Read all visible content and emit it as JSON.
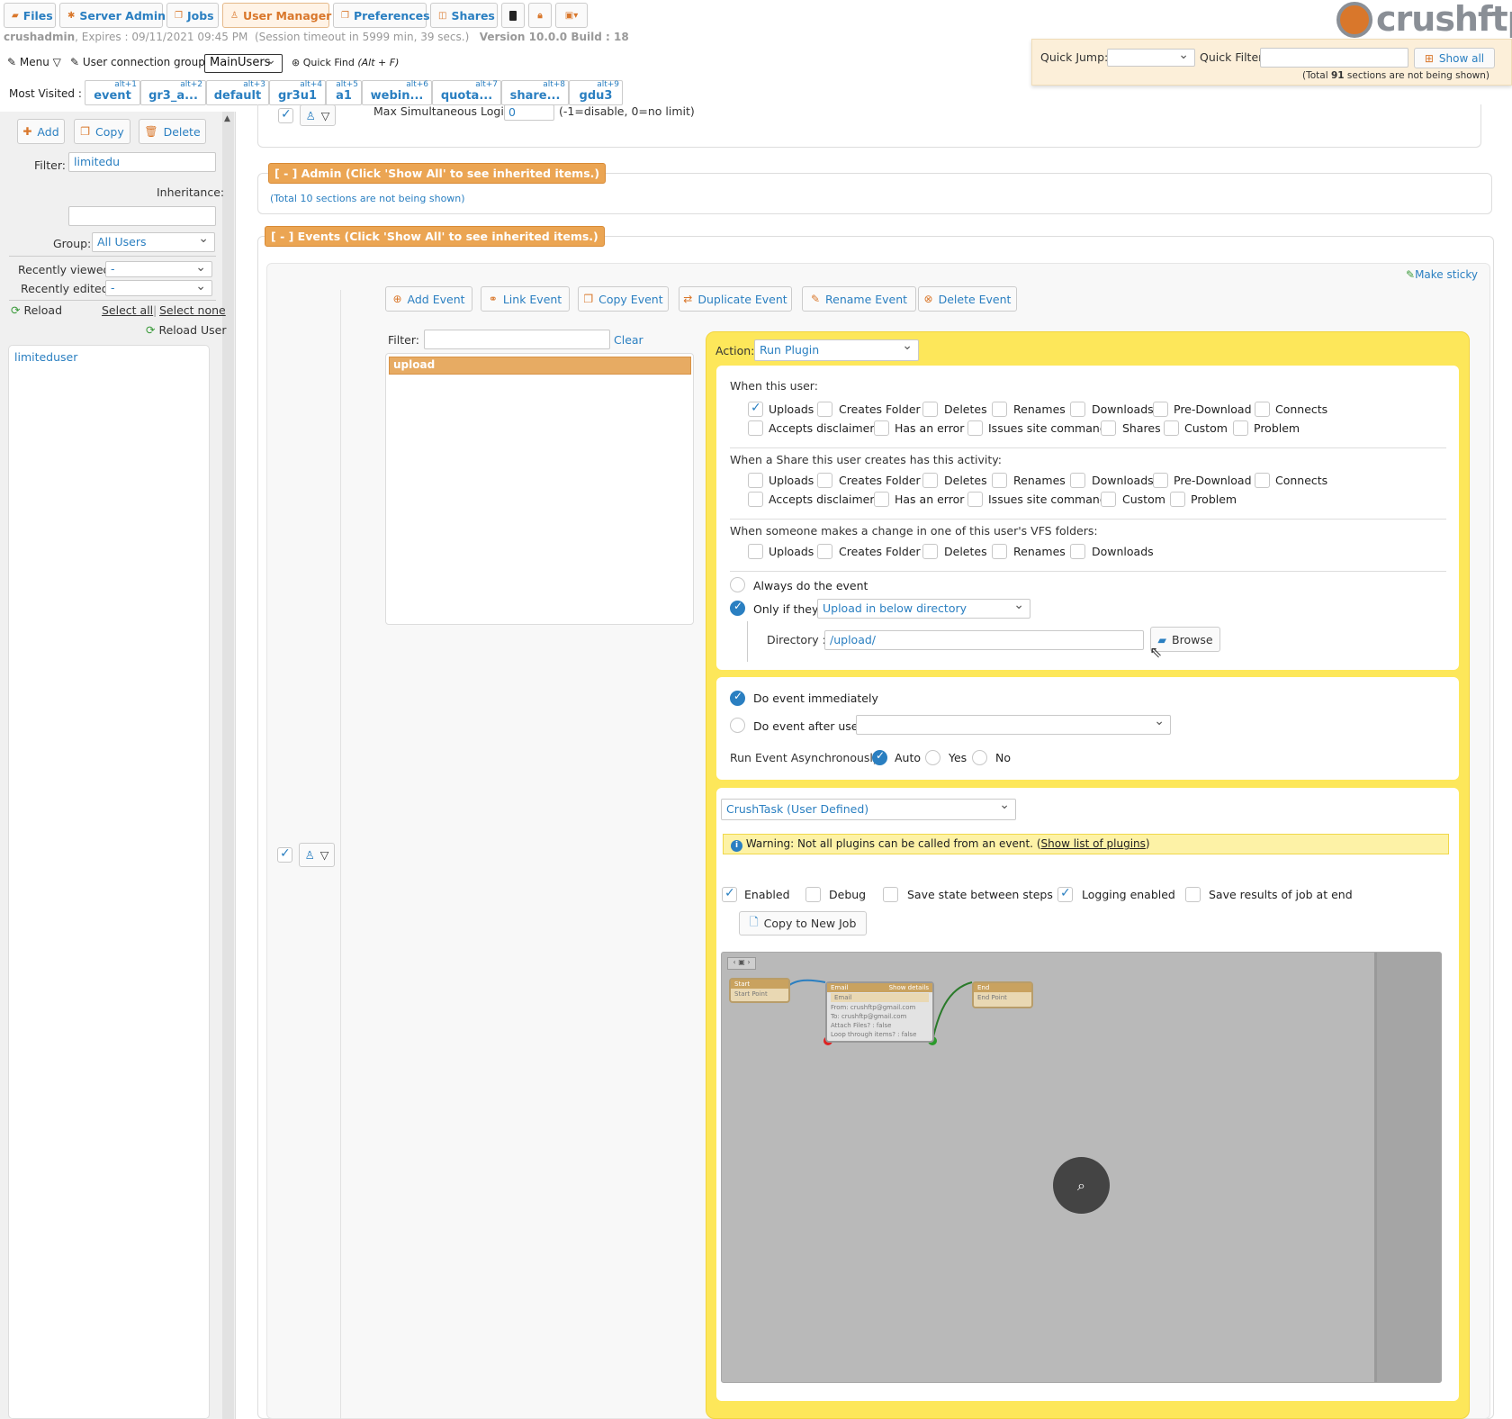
{
  "nav": {
    "tabs": [
      {
        "label": "Files",
        "icon": "folder-icon"
      },
      {
        "label": "Server Admin",
        "icon": "gear-icon"
      },
      {
        "label": "Jobs",
        "icon": "copy-icon"
      },
      {
        "label": "User Manager",
        "icon": "user-icon"
      },
      {
        "label": "Preferences",
        "icon": "copy-icon"
      },
      {
        "label": "Shares",
        "icon": "share-icon"
      }
    ],
    "logo_text": "crushftp"
  },
  "session": {
    "user": "crushadmin",
    "expires": ", Expires : 09/11/2021 09:45 PM",
    "timeout": "(Session timeout in 5999 min, 39 secs.)",
    "version": "Version 10.0.0 Build : 18"
  },
  "toolbar": {
    "menu_label": "Menu",
    "group_label": "User connection group:",
    "group_value": "MainUsers",
    "quick_find_label": "Quick Find",
    "quick_find_shortcut": "(Alt + F)",
    "most_visited_label": "Most Visited :",
    "most_visited": [
      {
        "key": "alt+1",
        "label": "event"
      },
      {
        "key": "alt+2",
        "label": "gr3_a..."
      },
      {
        "key": "alt+3",
        "label": "default"
      },
      {
        "key": "alt+4",
        "label": "gr3u1"
      },
      {
        "key": "alt+5",
        "label": "a1"
      },
      {
        "key": "alt+6",
        "label": "webin..."
      },
      {
        "key": "alt+7",
        "label": "quota..."
      },
      {
        "key": "alt+8",
        "label": "share..."
      },
      {
        "key": "alt+9",
        "label": "gdu3"
      }
    ]
  },
  "quick": {
    "jump_label": "Quick Jump:",
    "filter_label": "Quick Filter",
    "show_all": "Show all",
    "hidden_prefix": "(Total ",
    "hidden_count": "91",
    "hidden_suffix": " sections are not being shown)"
  },
  "sidebar": {
    "add": "Add",
    "copy": "Copy",
    "delete": "Delete",
    "filter_label": "Filter:",
    "filter_value": "limitedu",
    "inheritance_label": "Inheritance:",
    "group_label": "Group:",
    "group_value": "All Users",
    "recently_viewed_label": "Recently viewed:",
    "recently_viewed_value": "-",
    "recently_edited_label": "Recently edited:",
    "recently_edited_value": "-",
    "reload": "Reload",
    "select_all": "Select all",
    "separator": "|",
    "select_none": "Select none",
    "reload_user": "Reload User",
    "users": [
      "limiteduser"
    ]
  },
  "main": {
    "max_login_label": "Max Simultaneous Login:",
    "max_login_value": "0",
    "max_login_hint": "(-1=disable, 0=no limit)",
    "admin_section": "[ - ] Admin (Click 'Show All' to see inherited items.)",
    "admin_hidden_prefix": "(Total ",
    "admin_hidden_count": "10",
    "admin_hidden_suffix": " sections are not being shown)",
    "events_section": "[ - ] Events (Click 'Show All' to see inherited items.)",
    "make_sticky": "Make sticky"
  },
  "events": {
    "buttons": [
      "Add Event",
      "Link Event",
      "Copy Event",
      "Duplicate Event",
      "Rename Event",
      "Delete Event"
    ],
    "filter_label": "Filter:",
    "clear": "Clear",
    "list": [
      "upload"
    ],
    "action_label": "Action:",
    "action_value": "Run Plugin",
    "when_user_label": "When this user:",
    "when_user_row1": [
      {
        "label": "Uploads",
        "checked": true
      },
      {
        "label": "Creates Folder",
        "checked": false
      },
      {
        "label": "Deletes",
        "checked": false
      },
      {
        "label": "Renames",
        "checked": false
      },
      {
        "label": "Downloads",
        "checked": false
      },
      {
        "label": "Pre-Download",
        "checked": false
      },
      {
        "label": "Connects",
        "checked": false
      }
    ],
    "when_user_row2": [
      {
        "label": "Accepts disclaimer",
        "checked": false
      },
      {
        "label": "Has an error",
        "checked": false
      },
      {
        "label": "Issues site command",
        "checked": false
      },
      {
        "label": "Shares",
        "checked": false
      },
      {
        "label": "Custom",
        "checked": false
      },
      {
        "label": "Problem",
        "checked": false
      }
    ],
    "share_label": "When a Share this user creates has this activity:",
    "share_row1": [
      "Uploads",
      "Creates Folder",
      "Deletes",
      "Renames",
      "Downloads",
      "Pre-Download",
      "Connects"
    ],
    "share_row2": [
      "Accepts disclaimer",
      "Has an error",
      "Issues site command",
      "Custom",
      "Problem"
    ],
    "vfs_label": "When someone makes a change in one of this user's VFS folders:",
    "vfs_row": [
      "Uploads",
      "Creates Folder",
      "Deletes",
      "Renames",
      "Downloads"
    ],
    "always": "Always do the event",
    "only_if": "Only if they",
    "only_if_value": "Upload in below directory",
    "directory_label": "Directory :",
    "directory_value": "/upload/",
    "browse": "Browse",
    "do_immediately": "Do event immediately",
    "do_after": "Do event after user",
    "async_label": "Run Event Asynchronously:",
    "async_options": [
      "Auto",
      "Yes",
      "No"
    ],
    "plugin_value": "CrushTask (User Defined)",
    "warning_text": "Warning: Not all plugins can be called from an event.",
    "warning_paren_open": "(",
    "warning_link": "Show list of plugins",
    "warning_paren_close": ")",
    "flags": [
      {
        "label": "Enabled",
        "checked": true
      },
      {
        "label": "Debug",
        "checked": false
      },
      {
        "label": "Save state between steps",
        "checked": false
      },
      {
        "label": "Logging enabled",
        "checked": true
      },
      {
        "label": "Save results of job at end",
        "checked": false
      }
    ],
    "copy_job": "Copy to New Job"
  },
  "canvas": {
    "start_title": "Start",
    "start_point": "Start Point",
    "email_title": "Email",
    "email_details": "Show details",
    "email_sub": "Email",
    "email_lines": [
      "From: crushftp@gmail.com",
      "To: crushftp@gmail.com",
      "Attach Files? : false",
      "Loop through items? : false"
    ],
    "end_title": "End",
    "end_point": "End Point"
  },
  "colors": {
    "accent": "#2a7fc1",
    "orange": "#eba553",
    "yellow": "#fde75a",
    "quickbar": "#fcefd9"
  }
}
